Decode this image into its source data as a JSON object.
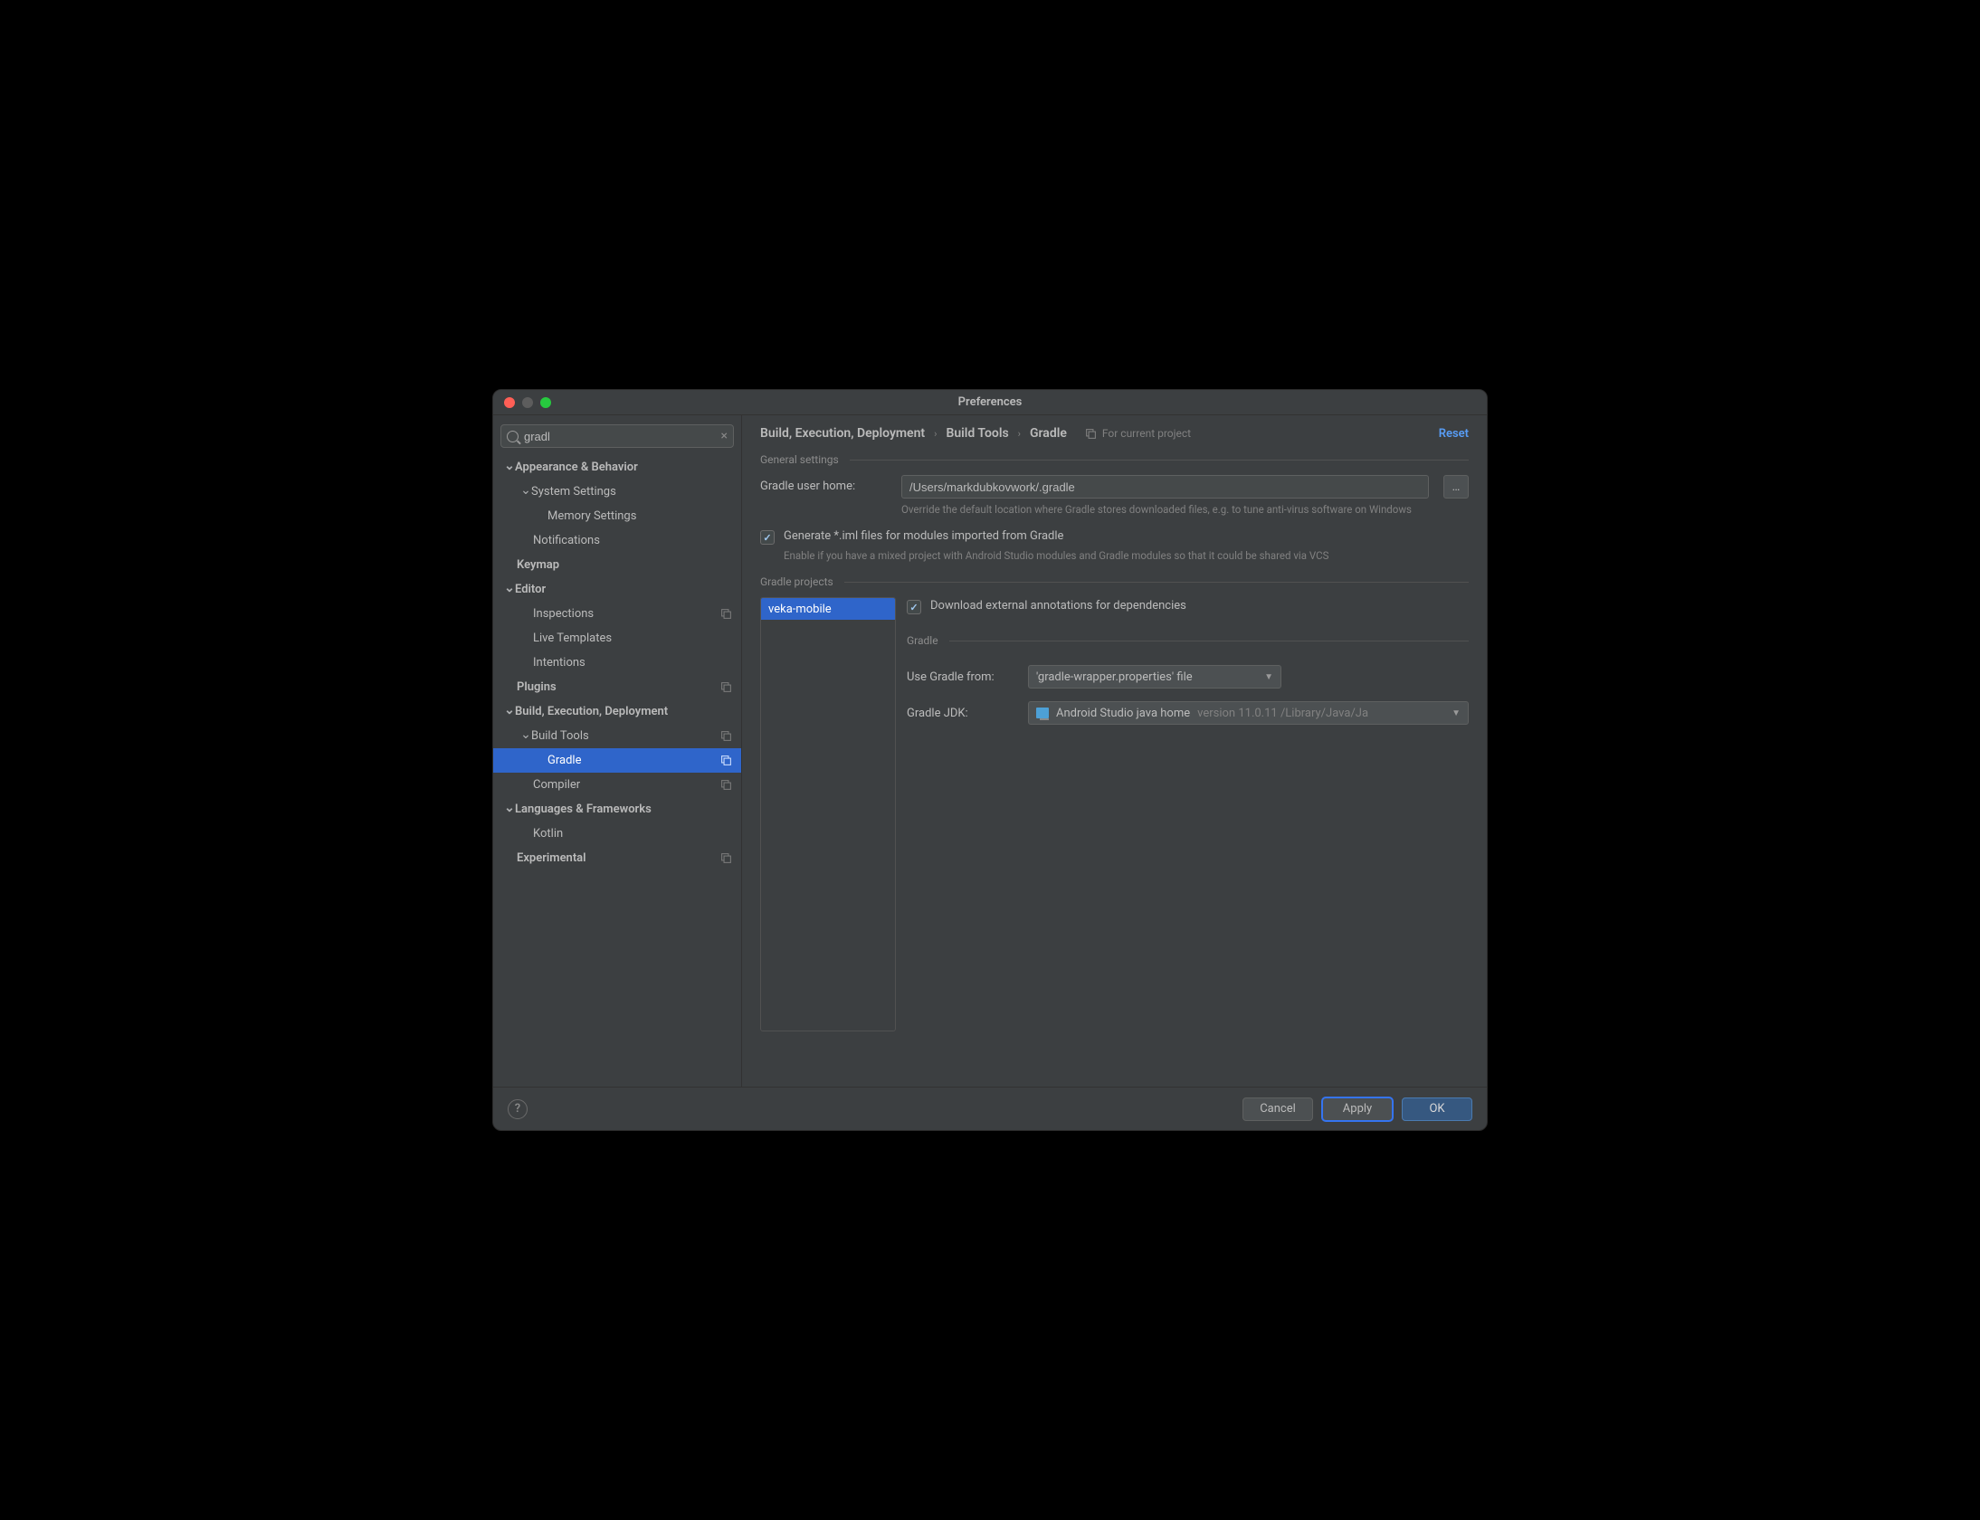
{
  "window": {
    "title": "Preferences"
  },
  "search": {
    "value": "gradl",
    "placeholder": ""
  },
  "sidebar": {
    "items": [
      {
        "label": "Appearance & Behavior",
        "bold": true,
        "expanded": true,
        "level": 0,
        "copy": false
      },
      {
        "label": "System Settings",
        "bold": false,
        "expanded": true,
        "level": 1,
        "copy": false
      },
      {
        "label": "Memory Settings",
        "bold": false,
        "expanded": false,
        "level": 2,
        "copy": false,
        "leaf": true
      },
      {
        "label": "Notifications",
        "bold": false,
        "expanded": false,
        "level": 1,
        "copy": false,
        "leaf": true
      },
      {
        "label": "Keymap",
        "bold": true,
        "expanded": false,
        "level": 0,
        "copy": false,
        "leaf": true
      },
      {
        "label": "Editor",
        "bold": true,
        "expanded": true,
        "level": 0,
        "copy": false
      },
      {
        "label": "Inspections",
        "bold": false,
        "expanded": false,
        "level": 1,
        "copy": true,
        "leaf": true
      },
      {
        "label": "Live Templates",
        "bold": false,
        "expanded": false,
        "level": 1,
        "copy": false,
        "leaf": true
      },
      {
        "label": "Intentions",
        "bold": false,
        "expanded": false,
        "level": 1,
        "copy": false,
        "leaf": true
      },
      {
        "label": "Plugins",
        "bold": true,
        "expanded": false,
        "level": 0,
        "copy": true,
        "leaf": true
      },
      {
        "label": "Build, Execution, Deployment",
        "bold": true,
        "expanded": true,
        "level": 0,
        "copy": false
      },
      {
        "label": "Build Tools",
        "bold": false,
        "expanded": true,
        "level": 1,
        "copy": true
      },
      {
        "label": "Gradle",
        "bold": false,
        "expanded": false,
        "level": 2,
        "copy": true,
        "leaf": true,
        "selected": true
      },
      {
        "label": "Compiler",
        "bold": false,
        "expanded": false,
        "level": 1,
        "copy": true,
        "leaf": true
      },
      {
        "label": "Languages & Frameworks",
        "bold": true,
        "expanded": true,
        "level": 0,
        "copy": false
      },
      {
        "label": "Kotlin",
        "bold": false,
        "expanded": false,
        "level": 1,
        "copy": false,
        "leaf": true
      },
      {
        "label": "Experimental",
        "bold": true,
        "expanded": false,
        "level": 0,
        "copy": true,
        "leaf": true
      }
    ]
  },
  "header": {
    "crumbs": [
      "Build, Execution, Deployment",
      "Build Tools",
      "Gradle"
    ],
    "scope": "For current project",
    "reset": "Reset"
  },
  "sections": {
    "general": "General settings",
    "projects": "Gradle projects",
    "gradle_sub": "Gradle"
  },
  "form": {
    "user_home_label": "Gradle user home:",
    "user_home_value": "/Users/markdubkovwork/.gradle",
    "user_home_hint": "Override the default location where Gradle stores downloaded files, e.g. to tune anti-virus software on Windows",
    "iml_label": "Generate *.iml files for modules imported from Gradle",
    "iml_hint": "Enable if you have a mixed project with Android Studio modules and Gradle modules so that it could be shared via VCS",
    "download_annotations": "Download external annotations for dependencies",
    "use_gradle_from_label": "Use Gradle from:",
    "use_gradle_from_value": "'gradle-wrapper.properties' file",
    "gradle_jdk_label": "Gradle JDK:",
    "gradle_jdk_value": "Android Studio java home",
    "gradle_jdk_secondary": "version 11.0.11 /Library/Java/Ja"
  },
  "projects": {
    "items": [
      "veka-mobile"
    ]
  },
  "footer": {
    "cancel": "Cancel",
    "apply": "Apply",
    "ok": "OK"
  }
}
